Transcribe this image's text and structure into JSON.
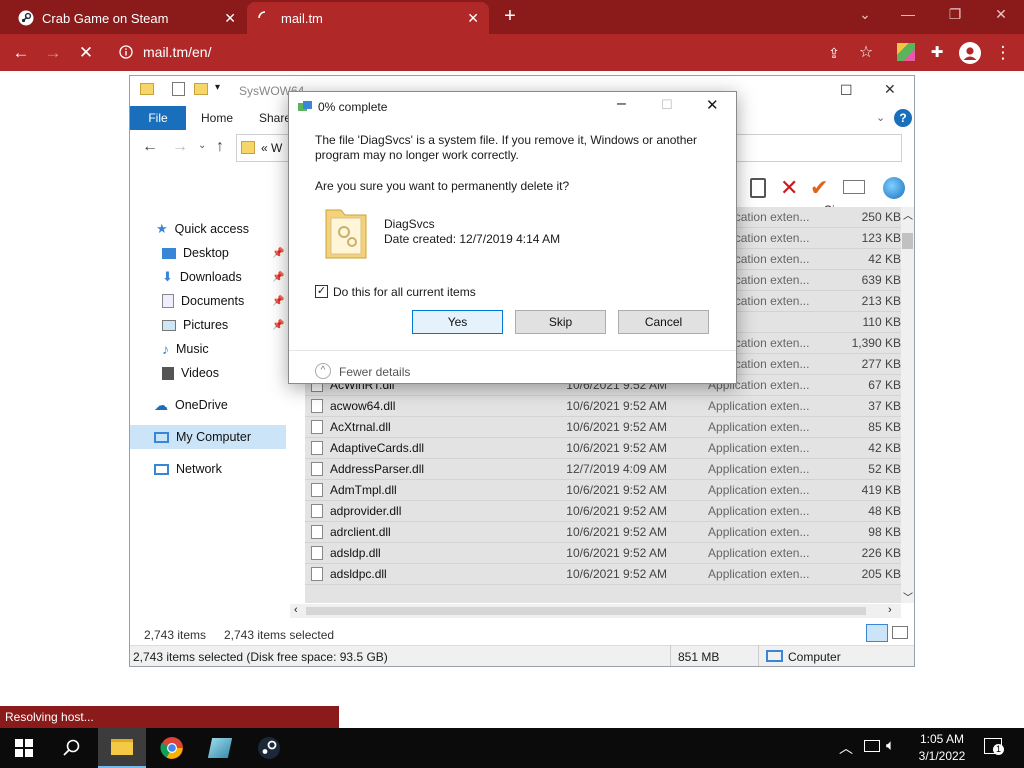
{
  "browser": {
    "tabs": [
      {
        "title": "Crab Game on Steam"
      },
      {
        "title": "mail.tm"
      }
    ],
    "url": "mail.tm/en/",
    "status_text": "Resolving host..."
  },
  "explorer": {
    "title": "SysWOW64",
    "ribbon_tabs": [
      "File",
      "Home",
      "Share"
    ],
    "address_crumb": "« W",
    "nav": [
      {
        "label": "Quick access",
        "icon": "star-icon"
      },
      {
        "label": "Desktop",
        "icon": "desktop-icon",
        "pinned": true
      },
      {
        "label": "Downloads",
        "icon": "download-icon",
        "pinned": true
      },
      {
        "label": "Documents",
        "icon": "documents-icon",
        "pinned": true
      },
      {
        "label": "Pictures",
        "icon": "pictures-icon",
        "pinned": true
      },
      {
        "label": "Music",
        "icon": "music-icon"
      },
      {
        "label": "Videos",
        "icon": "videos-icon"
      },
      {
        "label": "OneDrive",
        "icon": "cloud-icon"
      },
      {
        "label": "My Computer",
        "icon": "computer-icon"
      },
      {
        "label": "Network",
        "icon": "network-icon"
      }
    ],
    "columns": {
      "size": "Size"
    },
    "files": [
      {
        "name": "",
        "date": "",
        "type": "Application exten...",
        "size": "250 KB"
      },
      {
        "name": "",
        "date": "",
        "type": "Application exten...",
        "size": "123 KB"
      },
      {
        "name": "",
        "date": "",
        "type": "Application exten...",
        "size": "42 KB"
      },
      {
        "name": "",
        "date": "",
        "type": "Application exten...",
        "size": "639 KB"
      },
      {
        "name": "",
        "date": "",
        "type": "Application exten...",
        "size": "213 KB"
      },
      {
        "name": "",
        "date": "",
        "type": "File",
        "size": "110 KB"
      },
      {
        "name": "",
        "date": "",
        "type": "Application exten...",
        "size": "1,390 KB"
      },
      {
        "name": "acerpixy.dll",
        "date": "10/6/2021 9:52 AM",
        "type": "Application exten...",
        "size": "277 KB"
      },
      {
        "name": "AcWinRT.dll",
        "date": "10/6/2021 9:52 AM",
        "type": "Application exten...",
        "size": "67 KB"
      },
      {
        "name": "acwow64.dll",
        "date": "10/6/2021 9:52 AM",
        "type": "Application exten...",
        "size": "37 KB"
      },
      {
        "name": "AcXtrnal.dll",
        "date": "10/6/2021 9:52 AM",
        "type": "Application exten...",
        "size": "85 KB"
      },
      {
        "name": "AdaptiveCards.dll",
        "date": "10/6/2021 9:52 AM",
        "type": "Application exten...",
        "size": "42 KB"
      },
      {
        "name": "AddressParser.dll",
        "date": "12/7/2019 4:09 AM",
        "type": "Application exten...",
        "size": "52 KB"
      },
      {
        "name": "AdmTmpl.dll",
        "date": "10/6/2021 9:52 AM",
        "type": "Application exten...",
        "size": "419 KB"
      },
      {
        "name": "adprovider.dll",
        "date": "10/6/2021 9:52 AM",
        "type": "Application exten...",
        "size": "48 KB"
      },
      {
        "name": "adrclient.dll",
        "date": "10/6/2021 9:52 AM",
        "type": "Application exten...",
        "size": "98 KB"
      },
      {
        "name": "adsldp.dll",
        "date": "10/6/2021 9:52 AM",
        "type": "Application exten...",
        "size": "226 KB"
      },
      {
        "name": "adsldpc.dll",
        "date": "10/6/2021 9:52 AM",
        "type": "Application exten...",
        "size": "205 KB"
      }
    ],
    "status_items": "2,743 items",
    "status_selected": "2,743 items selected",
    "details_left": "2,743 items selected (Disk free space: 93.5 GB)",
    "details_size": "851 MB",
    "details_location": "Computer"
  },
  "dialog": {
    "title": "0% complete",
    "message": "The file 'DiagSvcs' is a system file. If you remove it, Windows or another program may no longer work correctly.",
    "question": "Are you sure you want to permanently delete it?",
    "file_name": "DiagSvcs",
    "file_date": "Date created: 12/7/2019 4:14 AM",
    "checkbox_label": "Do this for all current items",
    "checkbox_checked": true,
    "buttons": {
      "yes": "Yes",
      "skip": "Skip",
      "cancel": "Cancel"
    },
    "fewer_details": "Fewer details"
  },
  "taskbar": {
    "time": "1:05 AM",
    "date": "3/1/2022",
    "notification_count": "1"
  },
  "colors": {
    "browser_dark": "#8b1a1a",
    "browser_tab": "#b02828",
    "explorer_accent": "#1a6fbc"
  }
}
